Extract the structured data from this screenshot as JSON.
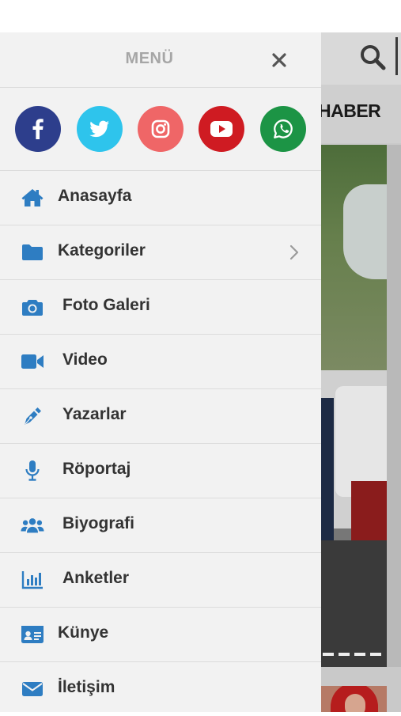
{
  "colors": {
    "accent": "#2e7dc2",
    "facebook": "#2d3e8c",
    "twitter": "#2ec4ec",
    "instagram": "#ef6667",
    "youtube": "#cf1b22",
    "whatsapp": "#1c9445"
  },
  "drawer": {
    "title": "MENÜ",
    "close_icon": "close-icon",
    "social": [
      {
        "name": "facebook",
        "icon": "facebook-icon"
      },
      {
        "name": "twitter",
        "icon": "twitter-icon"
      },
      {
        "name": "instagram",
        "icon": "instagram-icon"
      },
      {
        "name": "youtube",
        "icon": "youtube-icon"
      },
      {
        "name": "whatsapp",
        "icon": "whatsapp-icon"
      }
    ],
    "items": [
      {
        "label": "Anasayfa",
        "icon": "home-icon"
      },
      {
        "label": "Kategoriler",
        "icon": "folder-icon",
        "has_submenu": true
      },
      {
        "label": "Foto Galeri",
        "icon": "camera-icon"
      },
      {
        "label": "Video",
        "icon": "video-camera-icon"
      },
      {
        "label": "Yazarlar",
        "icon": "pen-icon"
      },
      {
        "label": "Röportaj",
        "icon": "microphone-icon"
      },
      {
        "label": "Biyografi",
        "icon": "users-icon"
      },
      {
        "label": "Anketler",
        "icon": "bar-chart-icon"
      },
      {
        "label": "Künye",
        "icon": "id-card-icon"
      },
      {
        "label": "İletişim",
        "icon": "envelope-icon"
      }
    ]
  },
  "background": {
    "header_text": "HABER",
    "search_icon": "search-icon"
  }
}
